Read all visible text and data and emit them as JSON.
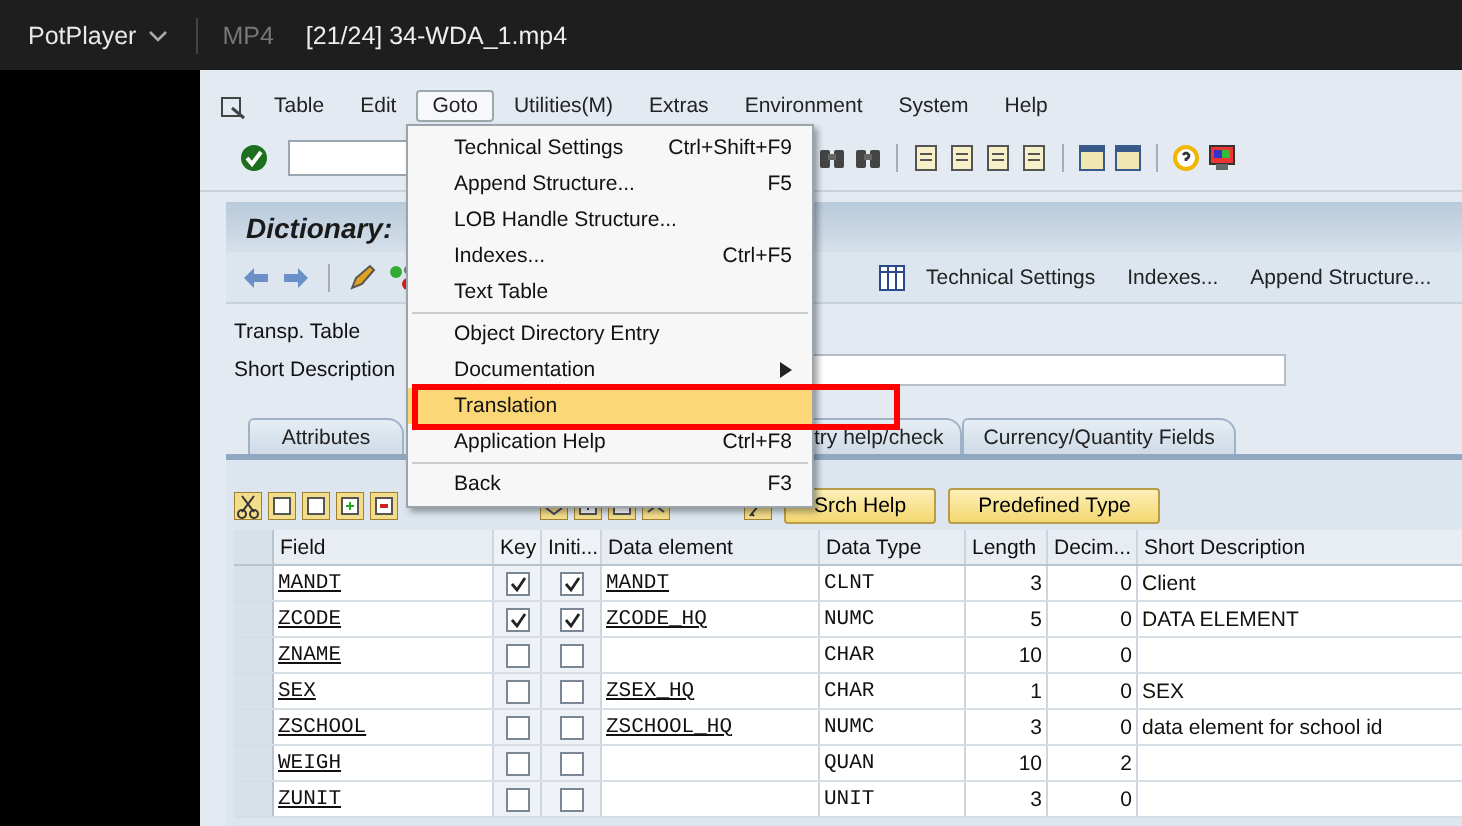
{
  "player": {
    "app_name": "PotPlayer",
    "format": "MP4",
    "file_title": "[21/24] 34-WDA_1.mp4"
  },
  "menubar": [
    {
      "label": "Table",
      "selected": false
    },
    {
      "label": "Edit",
      "selected": false
    },
    {
      "label": "Goto",
      "selected": true
    },
    {
      "label": "Utilities(M)",
      "selected": false
    },
    {
      "label": "Extras",
      "selected": false
    },
    {
      "label": "Environment",
      "selected": false
    },
    {
      "label": "System",
      "selected": false
    },
    {
      "label": "Help",
      "selected": false
    }
  ],
  "screen_title": "Dictionary:",
  "app_toolbar": [
    "Technical Settings",
    "Indexes...",
    "Append Structure..."
  ],
  "form": [
    {
      "label": "Transp. Table",
      "kind": "text"
    },
    {
      "label": "Short Description",
      "kind": "field"
    }
  ],
  "tabs": [
    {
      "label": "Attributes",
      "selected": false
    },
    {
      "label": "try help/check",
      "selected": false
    },
    {
      "label": "Currency/Quantity Fields",
      "selected": false
    }
  ],
  "table_buttons": [
    "Srch Help",
    "Predefined Type"
  ],
  "table": {
    "columns": [
      "Field",
      "Key",
      "Initi...",
      "Data element",
      "Data Type",
      "Length",
      "Decim...",
      "Short Description"
    ],
    "rows": [
      {
        "field": "MANDT",
        "key": true,
        "initial": true,
        "data_element": "MANDT",
        "data_type": "CLNT",
        "length": "3",
        "decimals": "0",
        "description": "Client"
      },
      {
        "field": "ZCODE",
        "key": true,
        "initial": true,
        "data_element": "ZCODE_HQ",
        "data_type": "NUMC",
        "length": "5",
        "decimals": "0",
        "description": "DATA ELEMENT"
      },
      {
        "field": "ZNAME",
        "key": false,
        "initial": false,
        "data_element": "",
        "data_type": "CHAR",
        "length": "10",
        "decimals": "0",
        "description": ""
      },
      {
        "field": "SEX",
        "key": false,
        "initial": false,
        "data_element": "ZSEX_HQ",
        "data_type": "CHAR",
        "length": "1",
        "decimals": "0",
        "description": "SEX"
      },
      {
        "field": "ZSCHOOL",
        "key": false,
        "initial": false,
        "data_element": "ZSCHOOL_HQ",
        "data_type": "NUMC",
        "length": "3",
        "decimals": "0",
        "description": "data element for school id"
      },
      {
        "field": "WEIGH",
        "key": false,
        "initial": false,
        "data_element": "",
        "data_type": "QUAN",
        "length": "10",
        "decimals": "2",
        "description": ""
      },
      {
        "field": "ZUNIT",
        "key": false,
        "initial": false,
        "data_element": "",
        "data_type": "UNIT",
        "length": "3",
        "decimals": "0",
        "description": ""
      }
    ]
  },
  "menu": [
    {
      "kind": "item",
      "label": "Technical Settings",
      "shortcut": "Ctrl+Shift+F9",
      "selected": false
    },
    {
      "kind": "item",
      "label": "Append Structure...",
      "shortcut": "F5",
      "selected": false
    },
    {
      "kind": "item",
      "label": "LOB Handle Structure...",
      "selected": false
    },
    {
      "kind": "item",
      "label": "Indexes...",
      "shortcut": "Ctrl+F5",
      "selected": false
    },
    {
      "kind": "item",
      "label": "Text Table",
      "selected": false
    },
    {
      "kind": "separator"
    },
    {
      "kind": "item",
      "label": "Object Directory Entry",
      "selected": false
    },
    {
      "kind": "submenu",
      "label": "Documentation",
      "selected": false
    },
    {
      "kind": "item",
      "label": "Translation",
      "selected": true
    },
    {
      "kind": "item",
      "label": "Application Help",
      "shortcut": "Ctrl+F8",
      "selected": false
    },
    {
      "kind": "separator"
    },
    {
      "kind": "item",
      "label": "Back",
      "shortcut": "F3",
      "selected": false
    }
  ]
}
